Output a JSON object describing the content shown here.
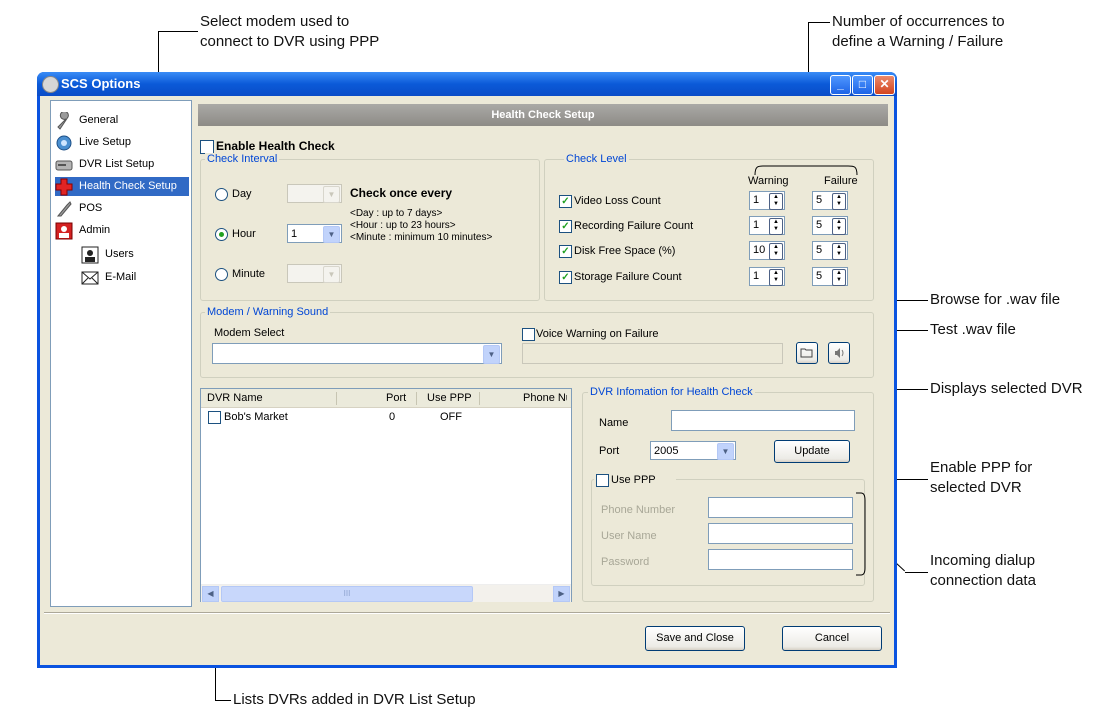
{
  "callouts": {
    "modem_select": [
      "Select modem used to",
      "connect to DVR using PPP"
    ],
    "occurrences": [
      "Number of occurrences to",
      "define a Warning / Failure"
    ],
    "browse_wav": "Browse for .wav file",
    "test_wav": "Test .wav file",
    "displays_dvr": "Displays selected DVR",
    "enable_ppp": [
      "Enable PPP for",
      "selected DVR"
    ],
    "incoming_dialup": [
      "Incoming dialup",
      "connection data"
    ],
    "lists_dvrs": "Lists DVRs added in DVR List Setup"
  },
  "window": {
    "title": "SCS Options",
    "controls": {
      "minimize": "_",
      "maximize": "□",
      "close": "✕"
    }
  },
  "nav": {
    "items": [
      {
        "label": "General",
        "icon": "wrench-icon"
      },
      {
        "label": "Live Setup",
        "icon": "camera-icon"
      },
      {
        "label": "DVR List Setup",
        "icon": "dvr-icon"
      },
      {
        "label": "Health Check Setup",
        "icon": "health-cross-icon",
        "selected": true
      },
      {
        "label": "POS",
        "icon": "pos-icon"
      },
      {
        "label": "Admin",
        "icon": "admin-icon"
      },
      {
        "label": "Users",
        "icon": "user-icon"
      },
      {
        "label": "E-Mail",
        "icon": "envelope-icon"
      }
    ]
  },
  "panel": {
    "header": "Health Check Setup",
    "enable_label": "Enable Health Check",
    "enable_checked": false
  },
  "check_interval": {
    "title": "Check Interval",
    "day": {
      "label": "Day",
      "value": ""
    },
    "hour": {
      "label": "Hour",
      "value": "1",
      "selected": true
    },
    "minute": {
      "label": "Minute",
      "value": ""
    },
    "heading": "Check once every",
    "notes": [
      "<Day : up to 7 days>",
      "<Hour : up to 23 hours>",
      "<Minute : minimum 10 minutes>"
    ]
  },
  "check_level": {
    "title": "Check Level",
    "col_warning": "Warning",
    "col_failure": "Failure",
    "rows": [
      {
        "label": "Video Loss Count",
        "checked": true,
        "warning": "1",
        "failure": "5"
      },
      {
        "label": "Recording Failure Count",
        "checked": true,
        "warning": "1",
        "failure": "5"
      },
      {
        "label": "Disk Free Space (%)",
        "checked": true,
        "warning": "10",
        "failure": "5"
      },
      {
        "label": "Storage Failure Count",
        "checked": true,
        "warning": "1",
        "failure": "5"
      }
    ]
  },
  "modem": {
    "title": "Modem / Warning Sound",
    "select_label": "Modem Select",
    "select_value": "",
    "voice_label": "Voice Warning on Failure",
    "voice_checked": false,
    "wav_path": ""
  },
  "dvr_list": {
    "columns": [
      "DVR Name",
      "Port",
      "Use PPP",
      "Phone Nu"
    ],
    "rows": [
      {
        "name": "Bob's Market",
        "port": "0",
        "ppp": "OFF"
      }
    ],
    "scroll_grip": "III"
  },
  "dvr_info": {
    "title": "DVR Infomation for Health Check",
    "name_label": "Name",
    "name_value": "",
    "port_label": "Port",
    "port_value": "2005",
    "update_label": "Update",
    "use_ppp_label": "Use PPP",
    "use_ppp_checked": false,
    "phone_label": "Phone Number",
    "user_label": "User Name",
    "password_label": "Password"
  },
  "footer": {
    "save_label": "Save and Close",
    "cancel_label": "Cancel"
  }
}
